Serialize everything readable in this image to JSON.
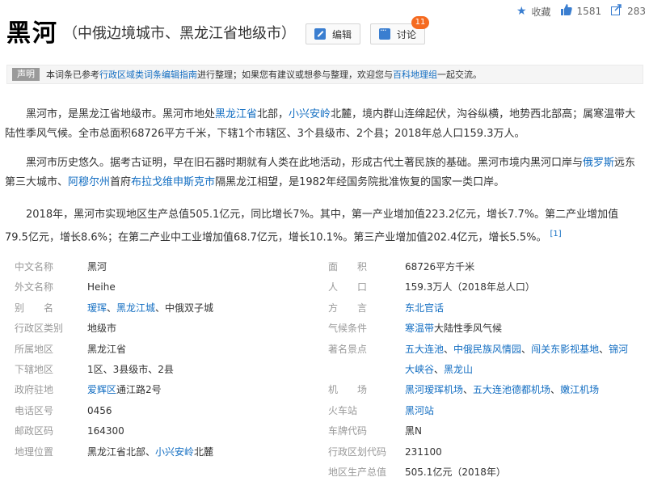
{
  "topbar": {
    "collect_label": "收藏",
    "like_count": "1581",
    "share_count": "283"
  },
  "header": {
    "title": "黑河",
    "subtitle": "（中俄边境城市、黑龙江省地级市）",
    "edit_label": "编辑",
    "discuss_label": "讨论",
    "discuss_badge": "11"
  },
  "notice": {
    "tag": "声明",
    "text_1": "本词条已参考",
    "link_1": "行政区域类词条编辑指南",
    "text_2": "进行整理；如果您有建议或想参与整理，欢迎您与",
    "link_2": "百科地理组",
    "text_3": "一起交流。"
  },
  "paragraphs": {
    "p1": {
      "t1": "黑河市，是黑龙江省地级市。黑河市地处",
      "l1": "黑龙江省",
      "t2": "北部，",
      "l2": "小兴安岭",
      "t3": "北麓，境内群山连绵起伏，沟谷纵横，地势西北部高；属寒温带大陆性季风气候。全市总面积68726平方千米，下辖1个市辖区、3个县级市、2个县；2018年总人口159.3万人。"
    },
    "p2": {
      "t1": "黑河市历史悠久。据考古证明，早在旧石器时期就有人类在此地活动，形成古代土著民族的基础。黑河市境内黑河口岸与",
      "l1": "俄罗斯",
      "t2": "远东第三大城市、",
      "l2": "阿穆尔州",
      "t3": "首府",
      "l3": "布拉戈维申斯克市",
      "t4": "隔黑龙江相望，是1982年经国务院批准恢复的国家一类口岸。"
    },
    "p3": {
      "t1": "2018年，黑河市实现地区生产总值505.1亿元，同比增长7%。其中，第一产业增加值223.2亿元，增长7.7%。第二产业增加值79.5亿元，增长8.6%；在第二产业中工业增加值68.7亿元，增长10.1%。第三产业增加值202.4亿元，增长5.5%。",
      "ref": "[1]"
    }
  },
  "info_left": [
    {
      "label": "中文名称",
      "value": "黑河"
    },
    {
      "label": "外文名称",
      "value": "Heihe"
    },
    {
      "label": "别　　名",
      "links": [
        "瑷珲",
        "黑龙江城"
      ],
      "sep": "、",
      "tail": "、中俄双子城"
    },
    {
      "label": "行政区类别",
      "value": "地级市"
    },
    {
      "label": "所属地区",
      "value": "黑龙江省"
    },
    {
      "label": "下辖地区",
      "value": "1区、3县级市、2县"
    },
    {
      "label": "政府驻地",
      "link": "爱辉区",
      "tail": "通江路2号"
    },
    {
      "label": "电话区号",
      "value": "0456"
    },
    {
      "label": "邮政区码",
      "value": "164300"
    },
    {
      "label": "地理位置",
      "head": "黑龙江省北部、",
      "link": "小兴安岭",
      "tail": "北麓"
    }
  ],
  "info_right": [
    {
      "label": "面　　积",
      "value": "68726平方千米"
    },
    {
      "label": "人　　口",
      "value": "159.3万人（2018年总人口）"
    },
    {
      "label": "方　　言",
      "link": "东北官话"
    },
    {
      "label": "气候条件",
      "link": "寒温带",
      "tail": "大陆性季风气候"
    },
    {
      "label": "著名景点",
      "line1": [
        "五大连池",
        "中俄民族风情园",
        "闯关东影视基地",
        "锦河"
      ],
      "line2": [
        "大峡谷",
        "黑龙山"
      ]
    },
    {
      "label": "机　　场",
      "links": [
        "黑河瑷珲机场",
        "五大连池德都机场",
        "嫩江机场"
      ]
    },
    {
      "label": "火车站",
      "link": "黑河站"
    },
    {
      "label": "车牌代码",
      "value": "黑N"
    },
    {
      "label": "行政区划代码",
      "value": "231100"
    },
    {
      "label": "地区生产总值",
      "value": "505.1亿元（2018年）"
    }
  ],
  "colors": {
    "link": "#136ec2",
    "badge": "#f56a1f",
    "icon_blue": "#3a7ed0"
  }
}
